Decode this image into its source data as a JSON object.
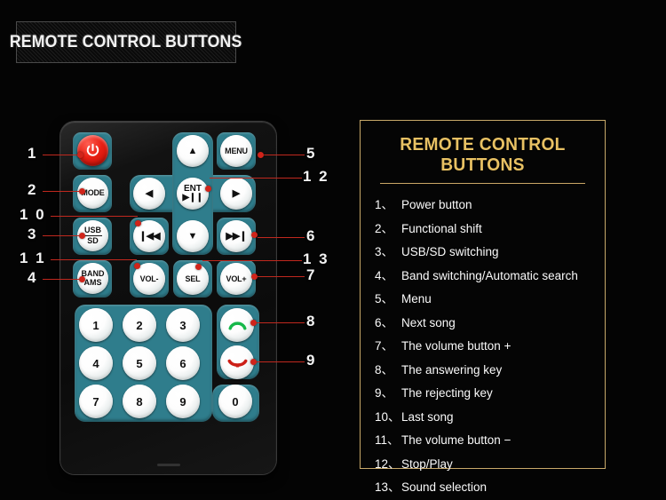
{
  "banner": {
    "title": "REMOTE CONTROL BUTTONS"
  },
  "panel": {
    "title": "REMOTE CONTROL BUTTONS",
    "items": [
      {
        "index": "1、",
        "label": "Power button"
      },
      {
        "index": "2、",
        "label": "Functional shift"
      },
      {
        "index": "3、",
        "label": "USB/SD switching"
      },
      {
        "index": "4、",
        "label": "Band switching/Automatic search"
      },
      {
        "index": "5、",
        "label": "Menu"
      },
      {
        "index": "6、",
        "label": "Next song"
      },
      {
        "index": "7、",
        "label": "The volume button +"
      },
      {
        "index": "8、",
        "label": "The answering key"
      },
      {
        "index": "9、",
        "label": "The rejecting key"
      },
      {
        "index": "10、",
        "label": "Last song"
      },
      {
        "index": "11、",
        "label": "The volume button −"
      },
      {
        "index": "12、",
        "label": "Stop/Play"
      },
      {
        "index": "13、",
        "label": "Sound selection"
      }
    ]
  },
  "remote": {
    "keys": {
      "power": "power-icon",
      "mode": "MODE",
      "usb": "USB",
      "sd": "SD",
      "band": "BAND",
      "ams": "AMS",
      "up": "▲",
      "down": "▼",
      "left": "◀",
      "right": "▶",
      "menu": "MENU",
      "ent": "ENT",
      "playpause": "▶❙❙",
      "prev": "❙◀◀",
      "next": "▶▶❙",
      "volminus": "VOL-",
      "volplus": "VOL+",
      "sel": "SEL",
      "answer": "answer-call-icon",
      "reject": "reject-call-icon",
      "num1": "1",
      "num2": "2",
      "num3": "3",
      "num4": "4",
      "num5": "5",
      "num6": "6",
      "num7": "7",
      "num8": "8",
      "num9": "9",
      "num0": "0"
    }
  },
  "callouts": {
    "left": [
      {
        "id": "c1",
        "text": "1"
      },
      {
        "id": "c2",
        "text": "2"
      },
      {
        "id": "c10",
        "text": "1 0"
      },
      {
        "id": "c3",
        "text": "3"
      },
      {
        "id": "c11",
        "text": "1 1"
      },
      {
        "id": "c4",
        "text": "4"
      }
    ],
    "right": [
      {
        "id": "c5",
        "text": "5"
      },
      {
        "id": "c12",
        "text": "1 2"
      },
      {
        "id": "c6",
        "text": "6"
      },
      {
        "id": "c13",
        "text": "1 3"
      },
      {
        "id": "c7",
        "text": "7"
      },
      {
        "id": "c8",
        "text": "8"
      },
      {
        "id": "c9",
        "text": "9"
      }
    ]
  },
  "colors": {
    "accent_gold": "#e8c163",
    "panel_border": "#c8a96a",
    "pad_teal": "#2f7d8c",
    "leader_red": "#c0281e",
    "power_red": "#e81f13",
    "answer_green": "#17b84a",
    "background": "#040404"
  }
}
